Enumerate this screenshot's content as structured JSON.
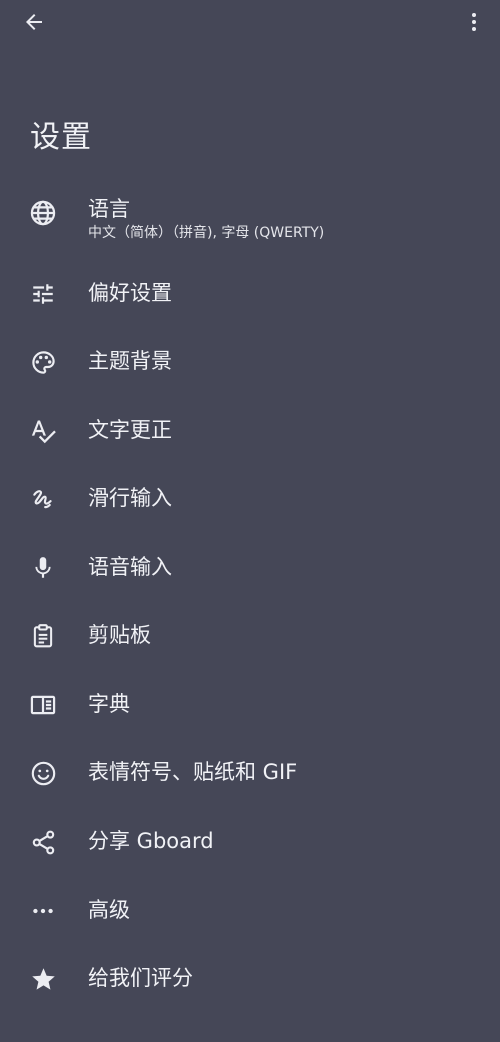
{
  "header": {
    "title": "设置",
    "back_icon": "arrow-left-icon",
    "more_icon": "more-vert-icon"
  },
  "items": [
    {
      "label": "语言",
      "sublabel": "中文（简体）（拼音), 字母 (QWERTY)",
      "icon": "globe-icon"
    },
    {
      "label": "偏好设置",
      "icon": "tune-sliders-icon"
    },
    {
      "label": "主题背景",
      "icon": "palette-icon"
    },
    {
      "label": "文字更正",
      "icon": "spellcheck-icon"
    },
    {
      "label": "滑行输入",
      "icon": "gesture-icon"
    },
    {
      "label": "语音输入",
      "icon": "microphone-icon"
    },
    {
      "label": "剪贴板",
      "icon": "clipboard-icon"
    },
    {
      "label": "字典",
      "icon": "dictionary-book-icon"
    },
    {
      "label": "表情符号、贴纸和 GIF",
      "icon": "smiley-face-icon"
    },
    {
      "label": "分享 Gboard",
      "icon": "share-icon"
    },
    {
      "label": "高级",
      "icon": "more-horiz-icon"
    },
    {
      "label": "给我们评分",
      "icon": "star-icon"
    }
  ],
  "colors": {
    "background": "#454757",
    "text": "#F1F2F6",
    "icon": "#ECEDF2"
  }
}
